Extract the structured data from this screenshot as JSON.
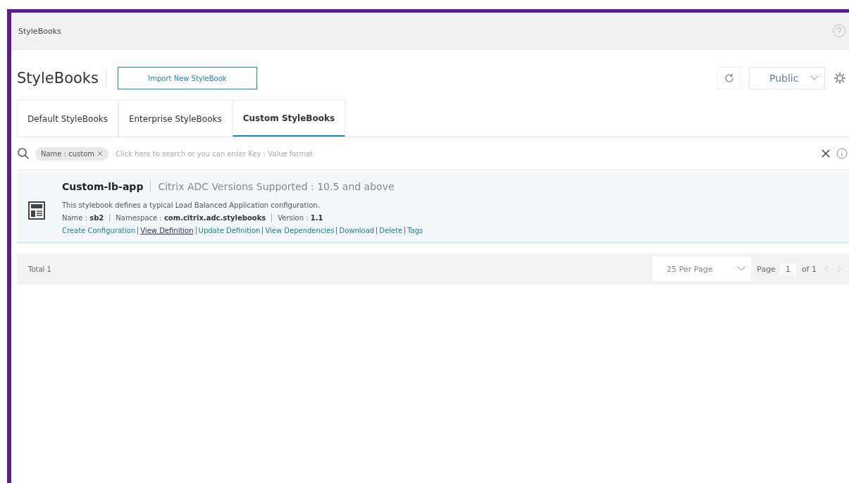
{
  "header": {
    "title": "StyleBooks"
  },
  "page": {
    "title": "StyleBooks",
    "import_button": "Import New StyleBook",
    "visibility": "Public"
  },
  "tabs": [
    {
      "label": "Default StyleBooks",
      "selected": false
    },
    {
      "label": "Enterprise StyleBooks",
      "selected": false
    },
    {
      "label": "Custom StyleBooks",
      "selected": true
    }
  ],
  "search": {
    "chip": "Name : custom",
    "placeholder": "Click here to search or you can enter Key : Value format"
  },
  "stylebooks": [
    {
      "name": "Custom-lb-app",
      "supported": "Citrix ADC Versions Supported : 10.5 and above",
      "description": "This stylebook defines a typical Load Balanced Application configuration.",
      "meta": [
        {
          "label": "Name :",
          "value": "sb2"
        },
        {
          "label": "Namespace :",
          "value": "com.citrix.adc.stylebooks"
        },
        {
          "label": "Version :",
          "value": "1.1"
        }
      ],
      "actions": [
        {
          "label": "Create Configuration",
          "hovered": false
        },
        {
          "label": "View Definition",
          "hovered": true
        },
        {
          "label": "Update Definition",
          "hovered": false
        },
        {
          "label": "View Dependencies",
          "hovered": false
        },
        {
          "label": "Download",
          "hovered": false
        },
        {
          "label": "Delete",
          "hovered": false
        },
        {
          "label": "Tags",
          "hovered": false
        }
      ]
    }
  ],
  "footer": {
    "total": "Total 1",
    "per_page": "25 Per Page",
    "page_label": "Page",
    "page": "1",
    "of": "of 1"
  }
}
